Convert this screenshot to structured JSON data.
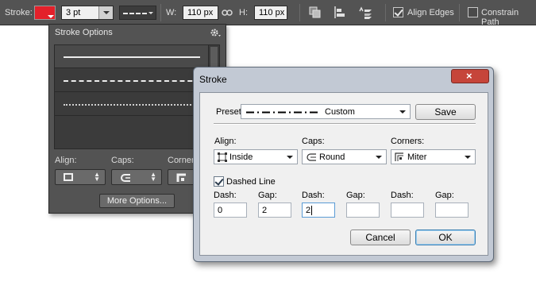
{
  "options_bar": {
    "stroke_label": "Stroke:",
    "stroke_color": "#e3202a",
    "stroke_width": "3 pt",
    "w_label": "W:",
    "w_value": "110 px",
    "h_label": "H:",
    "h_value": "110 px",
    "align_edges_label": "Align Edges",
    "align_edges_checked": true,
    "constrain_path_label": "Constrain Path",
    "constrain_path_checked": false
  },
  "stroke_options_panel": {
    "title": "Stroke Options",
    "presets": [
      "solid",
      "dashed",
      "dotted"
    ],
    "align_label": "Align:",
    "caps_label": "Caps:",
    "corners_label": "Corners:",
    "more_options_label": "More Options..."
  },
  "stroke_dialog": {
    "title": "Stroke",
    "preset_label": "Preset:",
    "preset_value": "Custom",
    "save_label": "Save",
    "align_label": "Align:",
    "align_value": "Inside",
    "caps_label": "Caps:",
    "caps_value": "Round",
    "corners_label": "Corners:",
    "corners_value": "Miter",
    "dashed_line_label": "Dashed Line",
    "dashed_line_checked": true,
    "dash_gap_fields": [
      {
        "label": "Dash:",
        "value": "0"
      },
      {
        "label": "Gap:",
        "value": "2"
      },
      {
        "label": "Dash:",
        "value": "2"
      },
      {
        "label": "Gap:",
        "value": ""
      },
      {
        "label": "Dash:",
        "value": ""
      },
      {
        "label": "Gap:",
        "value": ""
      }
    ],
    "cancel_label": "Cancel",
    "ok_label": "OK"
  }
}
